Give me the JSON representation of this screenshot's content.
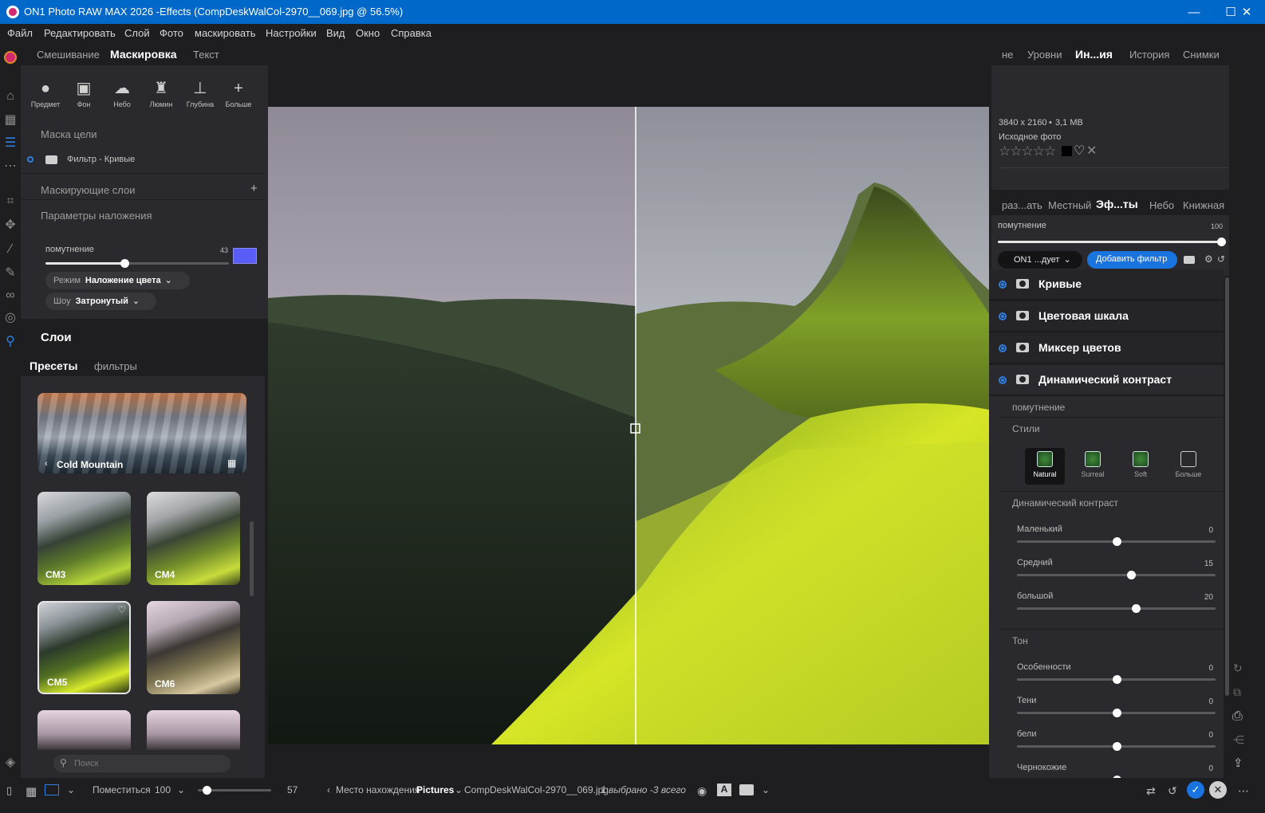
{
  "window": {
    "title": "ON1 Photo RAW MAX 2026 -Effects (CompDeskWalCol-2970__069.jpg @ 56.5%)"
  },
  "menu": [
    "Файл",
    "Редактировать",
    "Слой",
    "Фото",
    "маскировать",
    "Настройки",
    "Вид",
    "Окно",
    "Справка"
  ],
  "left_tabs": {
    "blend": "Смешивание",
    "mask": "Маскировка",
    "text": "Текст"
  },
  "mask_tools": [
    {
      "label": "Предмет",
      "icon": "person-icon"
    },
    {
      "label": "Фон",
      "icon": "portrait-icon"
    },
    {
      "label": "Небо",
      "icon": "cloud-sun-icon"
    },
    {
      "label": "Люмин",
      "icon": "lighthouse-icon"
    },
    {
      "label": "Глубина",
      "icon": "depth-icon"
    },
    {
      "label": "Больше",
      "icon": "plus-icon"
    }
  ],
  "mask": {
    "target_label": "Маска цели",
    "target_item": "Фильтр - Кривые",
    "masking_layers": "Маскирующие слои",
    "overlay_params": "Параметры наложения",
    "opacity_label": "помутнение",
    "opacity_value": "43",
    "opacity_fraction": 0.43,
    "overlay_color": "#5a5cf6",
    "mode_label": "Режим",
    "mode_value": "Наложение цвета",
    "show_label": "Шоу",
    "show_value": "Затронутый"
  },
  "layers_title": "Слои",
  "preset_tabs": {
    "presets": "Пресеты",
    "filters": "фильтры"
  },
  "presets": {
    "category": "Cold Mountain",
    "items": [
      "CM3",
      "CM4",
      "CM5",
      "CM6"
    ],
    "search_placeholder": "Поиск"
  },
  "right_tabs": [
    "не",
    "Уровни",
    "Ин...ия",
    "История",
    "Снимки"
  ],
  "info": {
    "dimensions": "3840 x 2160",
    "size": "3,1 MB",
    "source": "Исходное фото"
  },
  "module_tabs": [
    "раз...ать",
    "Местный",
    "Эф...ты",
    "Небо",
    "Книжная"
  ],
  "effects": {
    "opacity_label": "помутнение",
    "opacity_value": "100",
    "preset_dropdown": "ON1 ...дует",
    "add_filter": "Добавить фильтр",
    "filters": [
      "Кривые",
      "Цветовая шкала",
      "Миксер цветов",
      "Динамический контраст"
    ],
    "sub_opacity": "помутнение",
    "styles_label": "Стили",
    "styles": [
      "Natural",
      "Surreal",
      "Soft",
      "Больше"
    ],
    "dc_section": "Динамический контраст",
    "dc_sliders": [
      {
        "name": "Маленький",
        "value": "0",
        "fraction": 0.5
      },
      {
        "name": "Средний",
        "value": "15",
        "fraction": 0.575
      },
      {
        "name": "большой",
        "value": "20",
        "fraction": 0.6
      }
    ],
    "tone_section": "Тон",
    "tone_sliders": [
      {
        "name": "Особенности",
        "value": "0",
        "fraction": 0.5
      },
      {
        "name": "Тени",
        "value": "0",
        "fraction": 0.5
      },
      {
        "name": "бели",
        "value": "0",
        "fraction": 0.5
      },
      {
        "name": "Чернокожие",
        "value": "0",
        "fraction": 0.5
      }
    ]
  },
  "bottom": {
    "fit": "Поместиться",
    "zoom": "100",
    "thumb_size": "57",
    "thumb_fraction": 0.06,
    "location_label": "Место нахождения",
    "location": "Pictures",
    "filename": "CompDeskWalCol-2970__069.jpg",
    "selection": "1 выбрано -3 всего"
  }
}
